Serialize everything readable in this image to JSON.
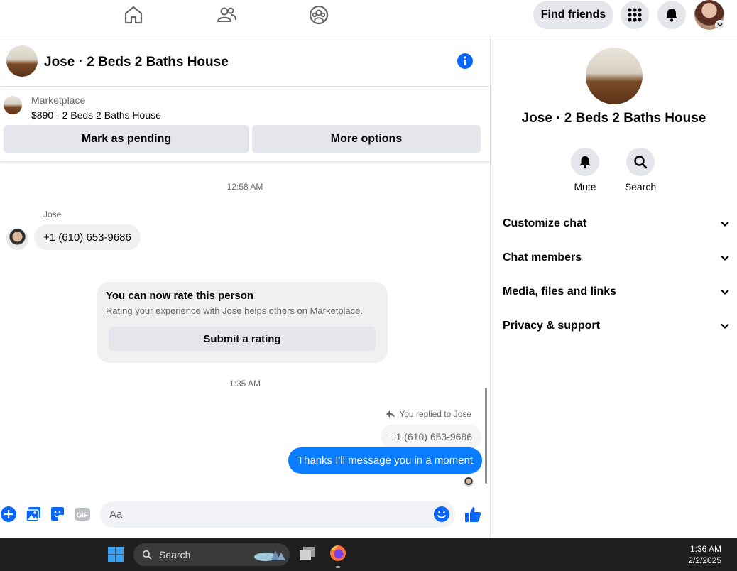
{
  "topnav": {
    "find_friends": "Find friends"
  },
  "conversation": {
    "title": "Jose · 2 Beds 2 Baths House",
    "marketplace_label": "Marketplace",
    "listing": "$890 - 2 Beds 2 Baths House",
    "mark_pending": "Mark as pending",
    "more_options": "More options"
  },
  "messages": {
    "time_1": "12:58 AM",
    "sender": "Jose",
    "phone_in": "+1 (610) 653-9686",
    "rate_title": "You can now rate this person",
    "rate_sub": "Rating your experience with Jose helps others on Marketplace.",
    "rate_button": "Submit a rating",
    "time_2": "1:35 AM",
    "reply_note": "You replied to Jose",
    "quoted": "+1 (610) 653-9686",
    "outgoing": "Thanks I'll message you in a moment"
  },
  "composer": {
    "placeholder": "Aa"
  },
  "sidebar": {
    "title": "Jose · 2 Beds 2 Baths House",
    "mute": "Mute",
    "search": "Search",
    "sections": [
      "Customize chat",
      "Chat members",
      "Media, files and links",
      "Privacy & support"
    ]
  },
  "taskbar": {
    "search": "Search",
    "time": "1:36 AM",
    "date": "2/2/2025"
  },
  "colors": {
    "accent": "#0866ff",
    "bubble_out": "#0a7cff",
    "bubble_in": "#f0f0f0",
    "button_bg": "#e4e6eb"
  },
  "icons": [
    "home-icon",
    "friends-icon",
    "groups-icon",
    "apps-grid-icon",
    "bell-icon",
    "info-icon",
    "plus-icon",
    "photo-icon",
    "sticker-icon",
    "gif-icon",
    "emoji-icon",
    "like-icon",
    "chevron-down-icon",
    "search-icon",
    "windows-icon",
    "firefox-icon"
  ]
}
